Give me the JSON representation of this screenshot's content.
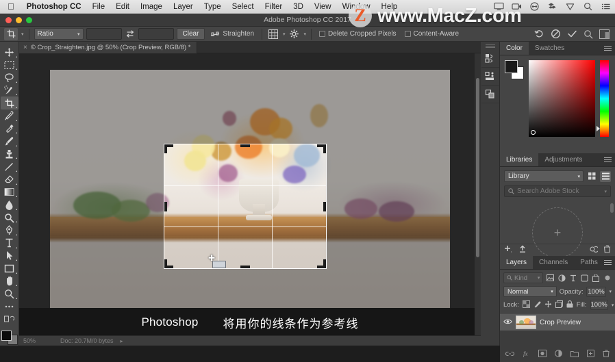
{
  "menubar": {
    "apple_icon": "apple-logo",
    "items": [
      {
        "label": "Photoshop CC",
        "bold": true
      },
      {
        "label": "File",
        "bold": false
      },
      {
        "label": "Edit",
        "bold": false
      },
      {
        "label": "Image",
        "bold": false
      },
      {
        "label": "Layer",
        "bold": false
      },
      {
        "label": "Type",
        "bold": false
      },
      {
        "label": "Select",
        "bold": false
      },
      {
        "label": "Filter",
        "bold": false
      },
      {
        "label": "3D",
        "bold": false
      },
      {
        "label": "View",
        "bold": false
      },
      {
        "label": "Window",
        "bold": false
      },
      {
        "label": "Help",
        "bold": false
      }
    ],
    "status_icons": [
      "display-icon",
      "screen-record-icon",
      "teamviewer-icon",
      "dropbox-icon",
      "shield-icon",
      "search-icon",
      "control-center-icon"
    ]
  },
  "window": {
    "title": "Adobe Photoshop CC 2017",
    "traffic_lights": [
      "close",
      "minimize",
      "zoom"
    ]
  },
  "watermark": {
    "badge_letter": "Z",
    "text": "www.MacZ.com"
  },
  "options_bar": {
    "tool_icon": "crop-tool-icon",
    "ratio_select": "Ratio",
    "width_value": "",
    "height_value": "",
    "swap_icon": "swap-dimensions-icon",
    "clear_label": "Clear",
    "straighten_icon": "straighten-icon",
    "straighten_label": "Straighten",
    "overlay_icon": "crop-overlay-grid-icon",
    "settings_icon": "gear-icon",
    "delete_cropped_pixels_label": "Delete Cropped Pixels",
    "delete_cropped_pixels_checked": false,
    "content_aware_label": "Content-Aware",
    "content_aware_checked": false,
    "reset_icon": "reset-icon",
    "cancel_icon": "cancel-icon",
    "commit_icon": "commit-checkmark-icon",
    "search_icon": "search-icon",
    "workspace_icon": "workspace-switcher-icon"
  },
  "document_tab": {
    "close_icon": "close-tab-icon",
    "title": "© Crop_Straighten.jpg @ 50% (Crop Preview, RGB/8) *"
  },
  "toolbar": {
    "tools": [
      {
        "name": "move-tool",
        "active": false
      },
      {
        "name": "rectangular-marquee-tool",
        "active": false
      },
      {
        "name": "lasso-tool",
        "active": false
      },
      {
        "name": "quick-selection-tool",
        "active": false
      },
      {
        "name": "crop-tool",
        "active": true
      },
      {
        "name": "eyedropper-tool",
        "active": false
      },
      {
        "name": "spot-healing-brush-tool",
        "active": false
      },
      {
        "name": "brush-tool",
        "active": false
      },
      {
        "name": "clone-stamp-tool",
        "active": false
      },
      {
        "name": "history-brush-tool",
        "active": false
      },
      {
        "name": "eraser-tool",
        "active": false
      },
      {
        "name": "gradient-tool",
        "active": false
      },
      {
        "name": "blur-tool",
        "active": false
      },
      {
        "name": "dodge-tool",
        "active": false
      },
      {
        "name": "pen-tool",
        "active": false
      },
      {
        "name": "horizontal-type-tool",
        "active": false
      },
      {
        "name": "path-selection-tool",
        "active": false
      },
      {
        "name": "rectangle-tool",
        "active": false
      },
      {
        "name": "hand-tool",
        "active": false
      },
      {
        "name": "zoom-tool",
        "active": false
      },
      {
        "name": "edit-toolbar-tool",
        "active": false
      }
    ],
    "foreground_color": "#0d0d0d",
    "background_color": "#7a7a7a"
  },
  "canvas": {
    "image_name": "Crop_Straighten.jpg",
    "crop_overlay": "rule-of-thirds",
    "cursor_icon": "crop-crosshair-cursor"
  },
  "status_bar": {
    "zoom": "50%",
    "doc_info": "Doc: 20.7M/0 bytes",
    "expand_icon": "status-expand-icon"
  },
  "dock_column": {
    "buttons": [
      "history-panel-icon",
      "properties-panel-icon",
      "layer-comps-panel-icon"
    ]
  },
  "color_panel": {
    "tabs": [
      {
        "label": "Color",
        "active": true
      },
      {
        "label": "Swatches",
        "active": false
      }
    ],
    "menu_icon": "panel-menu-icon",
    "foreground": "#1a1a1a",
    "background": "#ffffff",
    "ramp": "hue-strip"
  },
  "libraries_panel": {
    "tabs": [
      {
        "label": "Libraries",
        "active": true
      },
      {
        "label": "Adjustments",
        "active": false
      }
    ],
    "menu_icon": "panel-menu-icon",
    "library_select": "Library",
    "grid_view_icon": "grid-view-icon",
    "list_view_icon": "list-view-icon",
    "search_placeholder": "Search Adobe Stock",
    "search_value": "",
    "add_icon": "add-content-icon",
    "upload_icon": "upload-icon",
    "sync_icon": "sync-icon",
    "delete_icon": "trash-icon",
    "empty_plus": "+"
  },
  "layers_panel": {
    "tabs": [
      {
        "label": "Layers",
        "active": true
      },
      {
        "label": "Channels",
        "active": false
      },
      {
        "label": "Paths",
        "active": false
      }
    ],
    "menu_icon": "panel-menu-icon",
    "filter_kind": "Kind",
    "filter_icons": [
      "filter-pixel-icon",
      "filter-adjustment-icon",
      "filter-type-icon",
      "filter-shape-icon",
      "filter-smart-object-icon",
      "filter-toggle-icon"
    ],
    "blend_mode": "Normal",
    "opacity_label": "Opacity:",
    "opacity_value": "100%",
    "lock_label": "Lock:",
    "lock_icons": [
      "lock-transparency-icon",
      "lock-image-icon",
      "lock-position-icon",
      "lock-artboard-icon",
      "lock-all-icon"
    ],
    "fill_label": "Fill:",
    "fill_value": "100%",
    "layers": [
      {
        "name": "Crop Preview",
        "visible": true,
        "selected": true
      }
    ],
    "footer_icons": [
      "link-layers-icon",
      "layer-style-icon",
      "layer-mask-icon",
      "adjustment-layer-icon",
      "new-group-icon",
      "new-layer-icon",
      "delete-layer-icon"
    ]
  },
  "subtitle": {
    "english": "Photoshop",
    "chinese": "将用你的线条作为参考线"
  }
}
